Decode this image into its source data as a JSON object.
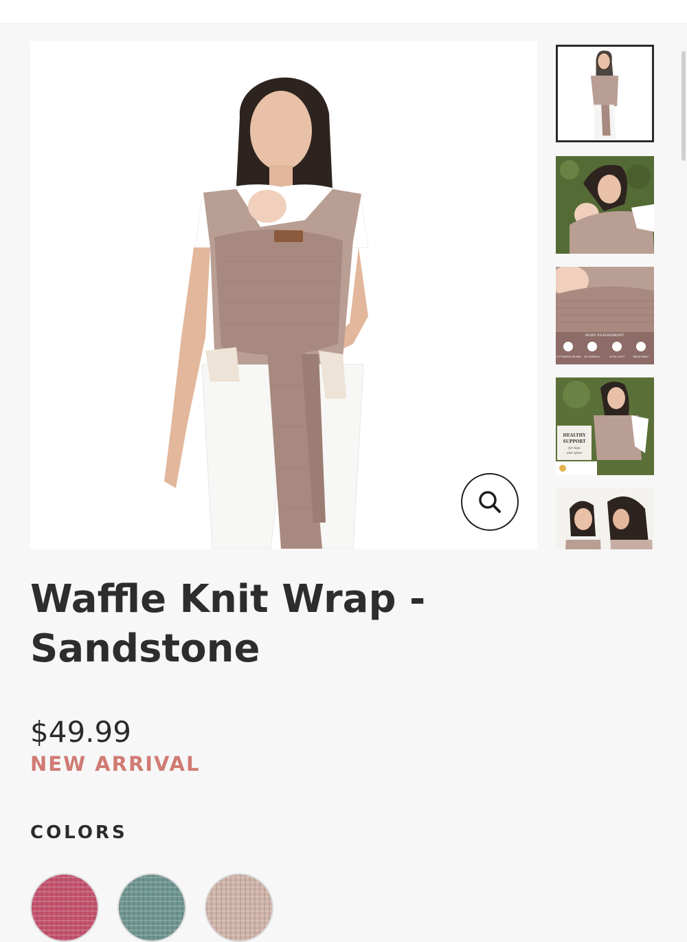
{
  "product": {
    "title": "Waffle Knit Wrap - Sandstone",
    "price": "$49.99",
    "badge": "NEW ARRIVAL",
    "badge_color": "#d07b74"
  },
  "gallery": {
    "main_image_alt": "Woman wearing sandstone waffle knit wrap with baby",
    "thumbnails": [
      {
        "name": "thumb-front-view",
        "active": true
      },
      {
        "name": "thumb-mother-hugging-baby",
        "active": false
      },
      {
        "name": "thumb-fabric-closeup",
        "active": false,
        "caption": "MOBY FEATHERKNIT",
        "features": [
          "COTTON/POLY BLEND",
          "NO HARMFUL CHEMICALS",
          "ULTRA LIGHTWEIGHT",
          "BREATHABLE"
        ]
      },
      {
        "name": "thumb-healthy-support",
        "active": false,
        "caption_lines": [
          "HEALTHY",
          "SUPPORT",
          "for hips",
          "and spine"
        ]
      },
      {
        "name": "thumb-two-women",
        "active": false
      }
    ]
  },
  "colors": {
    "label": "COLORS",
    "swatches": [
      {
        "name": "raspberry",
        "hex": "#c5536f"
      },
      {
        "name": "sage",
        "hex": "#6f9590"
      },
      {
        "name": "sandstone",
        "hex": "#cfb3a8"
      }
    ]
  },
  "icons": {
    "zoom": "magnifier-icon"
  }
}
